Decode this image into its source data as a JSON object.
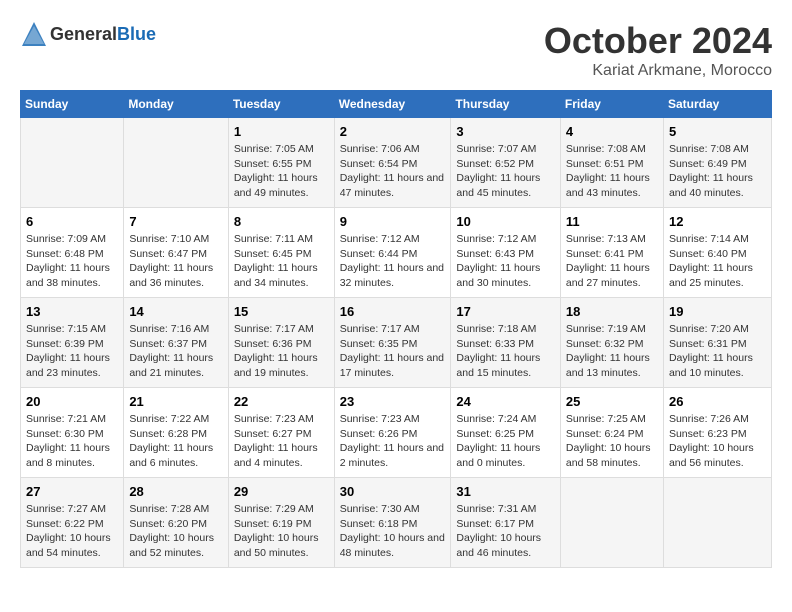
{
  "logo": {
    "text_general": "General",
    "text_blue": "Blue"
  },
  "title": "October 2024",
  "subtitle": "Kariat Arkmane, Morocco",
  "days_of_week": [
    "Sunday",
    "Monday",
    "Tuesday",
    "Wednesday",
    "Thursday",
    "Friday",
    "Saturday"
  ],
  "weeks": [
    [
      {
        "day": "",
        "sunrise": "",
        "sunset": "",
        "daylight": ""
      },
      {
        "day": "",
        "sunrise": "",
        "sunset": "",
        "daylight": ""
      },
      {
        "day": "1",
        "sunrise": "Sunrise: 7:05 AM",
        "sunset": "Sunset: 6:55 PM",
        "daylight": "Daylight: 11 hours and 49 minutes."
      },
      {
        "day": "2",
        "sunrise": "Sunrise: 7:06 AM",
        "sunset": "Sunset: 6:54 PM",
        "daylight": "Daylight: 11 hours and 47 minutes."
      },
      {
        "day": "3",
        "sunrise": "Sunrise: 7:07 AM",
        "sunset": "Sunset: 6:52 PM",
        "daylight": "Daylight: 11 hours and 45 minutes."
      },
      {
        "day": "4",
        "sunrise": "Sunrise: 7:08 AM",
        "sunset": "Sunset: 6:51 PM",
        "daylight": "Daylight: 11 hours and 43 minutes."
      },
      {
        "day": "5",
        "sunrise": "Sunrise: 7:08 AM",
        "sunset": "Sunset: 6:49 PM",
        "daylight": "Daylight: 11 hours and 40 minutes."
      }
    ],
    [
      {
        "day": "6",
        "sunrise": "Sunrise: 7:09 AM",
        "sunset": "Sunset: 6:48 PM",
        "daylight": "Daylight: 11 hours and 38 minutes."
      },
      {
        "day": "7",
        "sunrise": "Sunrise: 7:10 AM",
        "sunset": "Sunset: 6:47 PM",
        "daylight": "Daylight: 11 hours and 36 minutes."
      },
      {
        "day": "8",
        "sunrise": "Sunrise: 7:11 AM",
        "sunset": "Sunset: 6:45 PM",
        "daylight": "Daylight: 11 hours and 34 minutes."
      },
      {
        "day": "9",
        "sunrise": "Sunrise: 7:12 AM",
        "sunset": "Sunset: 6:44 PM",
        "daylight": "Daylight: 11 hours and 32 minutes."
      },
      {
        "day": "10",
        "sunrise": "Sunrise: 7:12 AM",
        "sunset": "Sunset: 6:43 PM",
        "daylight": "Daylight: 11 hours and 30 minutes."
      },
      {
        "day": "11",
        "sunrise": "Sunrise: 7:13 AM",
        "sunset": "Sunset: 6:41 PM",
        "daylight": "Daylight: 11 hours and 27 minutes."
      },
      {
        "day": "12",
        "sunrise": "Sunrise: 7:14 AM",
        "sunset": "Sunset: 6:40 PM",
        "daylight": "Daylight: 11 hours and 25 minutes."
      }
    ],
    [
      {
        "day": "13",
        "sunrise": "Sunrise: 7:15 AM",
        "sunset": "Sunset: 6:39 PM",
        "daylight": "Daylight: 11 hours and 23 minutes."
      },
      {
        "day": "14",
        "sunrise": "Sunrise: 7:16 AM",
        "sunset": "Sunset: 6:37 PM",
        "daylight": "Daylight: 11 hours and 21 minutes."
      },
      {
        "day": "15",
        "sunrise": "Sunrise: 7:17 AM",
        "sunset": "Sunset: 6:36 PM",
        "daylight": "Daylight: 11 hours and 19 minutes."
      },
      {
        "day": "16",
        "sunrise": "Sunrise: 7:17 AM",
        "sunset": "Sunset: 6:35 PM",
        "daylight": "Daylight: 11 hours and 17 minutes."
      },
      {
        "day": "17",
        "sunrise": "Sunrise: 7:18 AM",
        "sunset": "Sunset: 6:33 PM",
        "daylight": "Daylight: 11 hours and 15 minutes."
      },
      {
        "day": "18",
        "sunrise": "Sunrise: 7:19 AM",
        "sunset": "Sunset: 6:32 PM",
        "daylight": "Daylight: 11 hours and 13 minutes."
      },
      {
        "day": "19",
        "sunrise": "Sunrise: 7:20 AM",
        "sunset": "Sunset: 6:31 PM",
        "daylight": "Daylight: 11 hours and 10 minutes."
      }
    ],
    [
      {
        "day": "20",
        "sunrise": "Sunrise: 7:21 AM",
        "sunset": "Sunset: 6:30 PM",
        "daylight": "Daylight: 11 hours and 8 minutes."
      },
      {
        "day": "21",
        "sunrise": "Sunrise: 7:22 AM",
        "sunset": "Sunset: 6:28 PM",
        "daylight": "Daylight: 11 hours and 6 minutes."
      },
      {
        "day": "22",
        "sunrise": "Sunrise: 7:23 AM",
        "sunset": "Sunset: 6:27 PM",
        "daylight": "Daylight: 11 hours and 4 minutes."
      },
      {
        "day": "23",
        "sunrise": "Sunrise: 7:23 AM",
        "sunset": "Sunset: 6:26 PM",
        "daylight": "Daylight: 11 hours and 2 minutes."
      },
      {
        "day": "24",
        "sunrise": "Sunrise: 7:24 AM",
        "sunset": "Sunset: 6:25 PM",
        "daylight": "Daylight: 11 hours and 0 minutes."
      },
      {
        "day": "25",
        "sunrise": "Sunrise: 7:25 AM",
        "sunset": "Sunset: 6:24 PM",
        "daylight": "Daylight: 10 hours and 58 minutes."
      },
      {
        "day": "26",
        "sunrise": "Sunrise: 7:26 AM",
        "sunset": "Sunset: 6:23 PM",
        "daylight": "Daylight: 10 hours and 56 minutes."
      }
    ],
    [
      {
        "day": "27",
        "sunrise": "Sunrise: 7:27 AM",
        "sunset": "Sunset: 6:22 PM",
        "daylight": "Daylight: 10 hours and 54 minutes."
      },
      {
        "day": "28",
        "sunrise": "Sunrise: 7:28 AM",
        "sunset": "Sunset: 6:20 PM",
        "daylight": "Daylight: 10 hours and 52 minutes."
      },
      {
        "day": "29",
        "sunrise": "Sunrise: 7:29 AM",
        "sunset": "Sunset: 6:19 PM",
        "daylight": "Daylight: 10 hours and 50 minutes."
      },
      {
        "day": "30",
        "sunrise": "Sunrise: 7:30 AM",
        "sunset": "Sunset: 6:18 PM",
        "daylight": "Daylight: 10 hours and 48 minutes."
      },
      {
        "day": "31",
        "sunrise": "Sunrise: 7:31 AM",
        "sunset": "Sunset: 6:17 PM",
        "daylight": "Daylight: 10 hours and 46 minutes."
      },
      {
        "day": "",
        "sunrise": "",
        "sunset": "",
        "daylight": ""
      },
      {
        "day": "",
        "sunrise": "",
        "sunset": "",
        "daylight": ""
      }
    ]
  ]
}
